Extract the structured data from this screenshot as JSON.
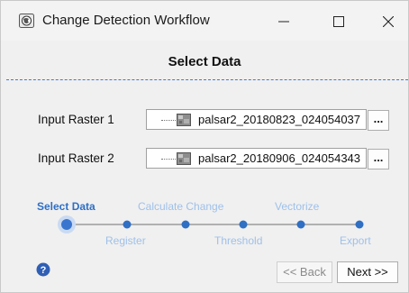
{
  "window": {
    "title": "Change Detection Workflow",
    "minimize_glyph": "—",
    "maximize_glyph": "☐",
    "close_glyph": "✕",
    "app_icon": "globe-icon"
  },
  "header": {
    "title": "Select Data"
  },
  "inputs": [
    {
      "label": "Input Raster 1",
      "value": "palsar2_20180823_024054037",
      "browse_label": "..."
    },
    {
      "label": "Input Raster 2",
      "value": "palsar2_20180906_024054343",
      "browse_label": "..."
    }
  ],
  "steps": {
    "top": [
      "Select Data",
      "Calculate Change",
      "Vectorize"
    ],
    "bottom": [
      "Register",
      "Threshold",
      "Export"
    ],
    "current": "Select Data"
  },
  "footer": {
    "help_icon": "help-icon",
    "back_label": "<< Back",
    "next_label": "Next >>"
  },
  "colors": {
    "accent": "#2f6fc4",
    "step_inactive": "#9fc0ea",
    "dash": "#3c7bd8"
  }
}
